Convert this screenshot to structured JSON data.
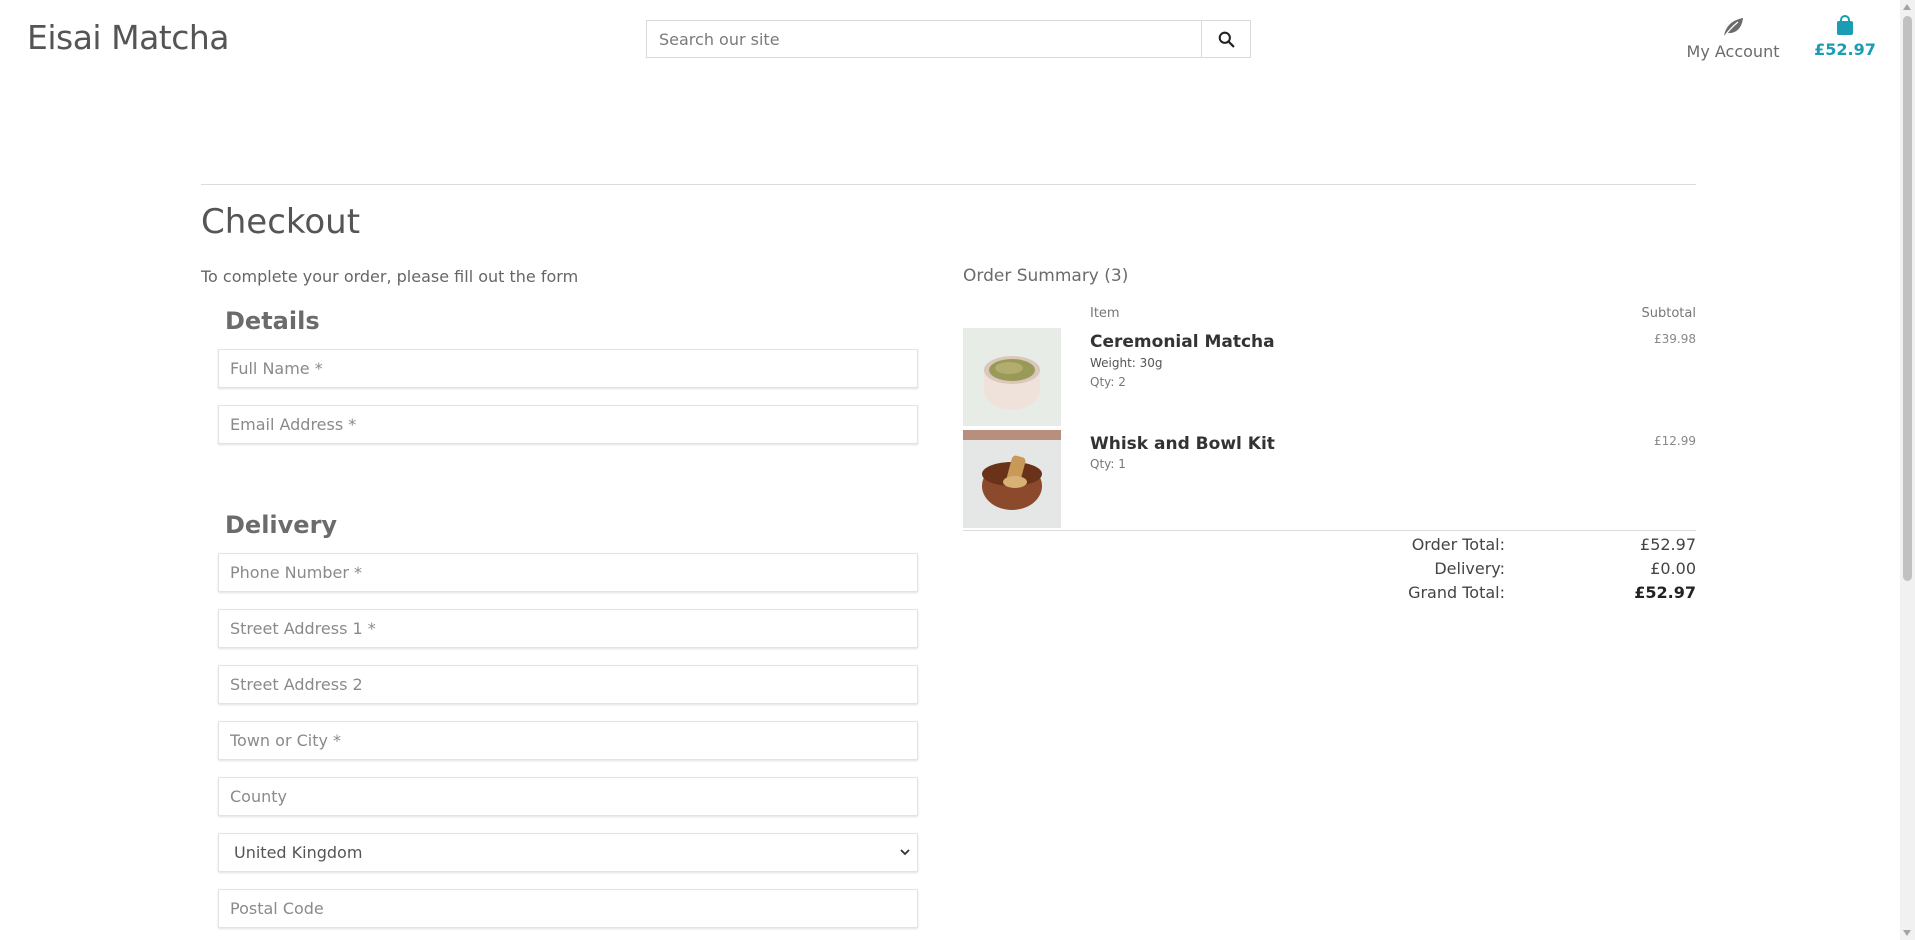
{
  "header": {
    "brand": "Eisai Matcha",
    "search_placeholder": "Search our site",
    "account_label": "My Account",
    "cart_total": "£52.97",
    "accent_color": "#1a9db3"
  },
  "checkout": {
    "title": "Checkout",
    "intro": "To complete your order, please fill out the form"
  },
  "form": {
    "details_title": "Details",
    "full_name_placeholder": "Full Name *",
    "email_placeholder": "Email Address *",
    "delivery_title": "Delivery",
    "phone_placeholder": "Phone Number *",
    "street1_placeholder": "Street Address 1 *",
    "street2_placeholder": "Street Address 2",
    "town_placeholder": "Town or City *",
    "county_placeholder": "County",
    "country_selected": "United Kingdom",
    "postcode_placeholder": "Postal Code"
  },
  "summary": {
    "title": "Order Summary (3)",
    "col_item": "Item",
    "col_subtotal": "Subtotal",
    "items": [
      {
        "name": "Ceremonial Matcha",
        "weight": "Weight: 30g",
        "qty": "Qty: 2",
        "price": "£39.98"
      },
      {
        "name": "Whisk and Bowl Kit",
        "qty": "Qty: 1",
        "price": "£12.99"
      }
    ],
    "order_total_label": "Order Total:",
    "order_total_value": "£52.97",
    "delivery_label": "Delivery:",
    "delivery_value": "£0.00",
    "grand_total_label": "Grand Total:",
    "grand_total_value": "£52.97"
  }
}
